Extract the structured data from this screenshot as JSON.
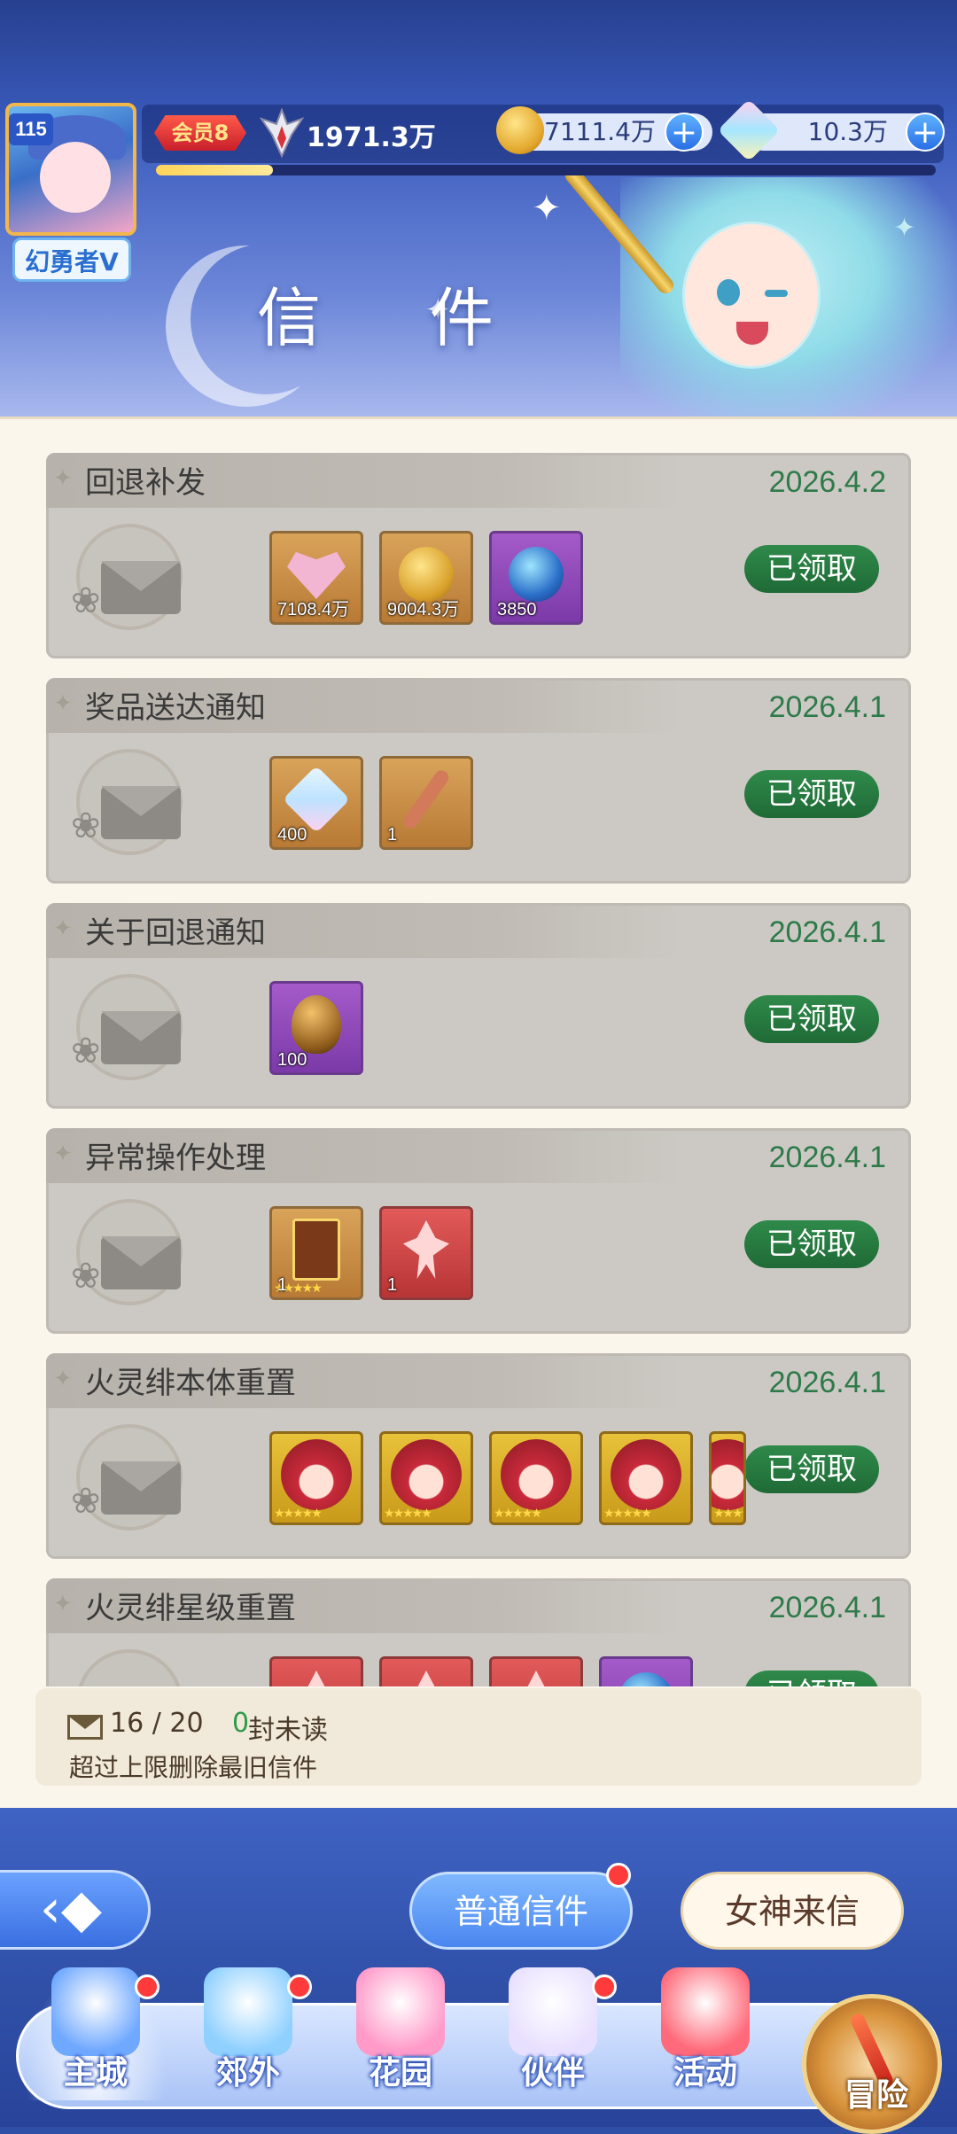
{
  "header": {
    "title": "信 件",
    "player": {
      "level": "115",
      "name": "幻勇者V",
      "vip": "会员8",
      "power": "1971.3万",
      "exp_progress": 0.15
    },
    "currency": [
      {
        "icon": "gold-coin-icon",
        "value": "7111.4万"
      },
      {
        "icon": "diamond-gem-icon",
        "value": "10.3万"
      }
    ]
  },
  "mails": [
    {
      "title": "回退补发",
      "date": "2026.4.2",
      "status": "已领取",
      "items": [
        {
          "icon": "heart-item-icon",
          "qty": "7108.4万",
          "frame": "gold"
        },
        {
          "icon": "gold-coin-icon",
          "qty": "9004.3万",
          "frame": "gold"
        },
        {
          "icon": "crystal-ball-icon",
          "qty": "3850",
          "frame": "purple"
        }
      ]
    },
    {
      "title": "奖品送达通知",
      "date": "2026.4.1",
      "status": "已领取",
      "items": [
        {
          "icon": "diamond-gem-icon",
          "qty": "400",
          "frame": "gold"
        },
        {
          "icon": "staff-item-icon",
          "qty": "1",
          "frame": "gold"
        }
      ]
    },
    {
      "title": "关于回退通知",
      "date": "2026.4.1",
      "status": "已领取",
      "items": [
        {
          "icon": "ore-item-icon",
          "qty": "100",
          "frame": "purple"
        }
      ]
    },
    {
      "title": "异常操作处理",
      "date": "2026.4.1",
      "status": "已领取",
      "items": [
        {
          "icon": "character-card-icon",
          "qty": "1",
          "frame": "gold"
        },
        {
          "icon": "fairy-card-icon",
          "qty": "1",
          "frame": "red"
        }
      ]
    },
    {
      "title": "火灵绯本体重置",
      "date": "2026.4.1",
      "status": "已领取",
      "items": [
        {
          "icon": "hero-portrait-icon",
          "qty": "",
          "frame": "yellow"
        },
        {
          "icon": "hero-portrait-icon",
          "qty": "",
          "frame": "yellow"
        },
        {
          "icon": "hero-portrait-icon",
          "qty": "",
          "frame": "yellow"
        },
        {
          "icon": "hero-portrait-icon",
          "qty": "",
          "frame": "yellow"
        },
        {
          "icon": "hero-portrait-icon",
          "qty": "",
          "frame": "yellow"
        }
      ]
    },
    {
      "title": "火灵绯星级重置",
      "date": "2026.4.1",
      "status": "已领取",
      "items": [
        {
          "icon": "fairy-card-icon",
          "qty": "",
          "frame": "red"
        },
        {
          "icon": "fairy-card-icon",
          "qty": "",
          "frame": "red"
        },
        {
          "icon": "fairy-card-icon",
          "qty": "",
          "frame": "red"
        },
        {
          "icon": "crystal-ball-icon",
          "qty": "",
          "frame": "purple"
        }
      ]
    }
  ],
  "footer": {
    "mail_count": "16 / 20",
    "unread_count": "0",
    "unread_label": "封未读",
    "limit_note": "超过上限删除最旧信件"
  },
  "tabs": [
    {
      "label": "普通信件",
      "active": true,
      "notify": true
    },
    {
      "label": "女神来信",
      "active": false,
      "notify": false
    }
  ],
  "nav": [
    {
      "label": "主城",
      "icon": "castle-icon",
      "notify": true,
      "active": true
    },
    {
      "label": "郊外",
      "icon": "portal-icon",
      "notify": true,
      "active": false
    },
    {
      "label": "花园",
      "icon": "heart-garden-icon",
      "notify": false,
      "active": false
    },
    {
      "label": "伙伴",
      "icon": "partner-avatar-icon",
      "notify": true,
      "active": false
    },
    {
      "label": "活动",
      "icon": "gift-box-icon",
      "notify": false,
      "active": false
    },
    {
      "label": "冒险",
      "icon": "compass-icon",
      "notify": false,
      "active": false
    }
  ],
  "colors": {
    "accent_green": "#2e7a49",
    "claim_button": "#1f6a36",
    "notify_red": "#ff3a3a",
    "brand_blue": "#2f4fa6"
  }
}
